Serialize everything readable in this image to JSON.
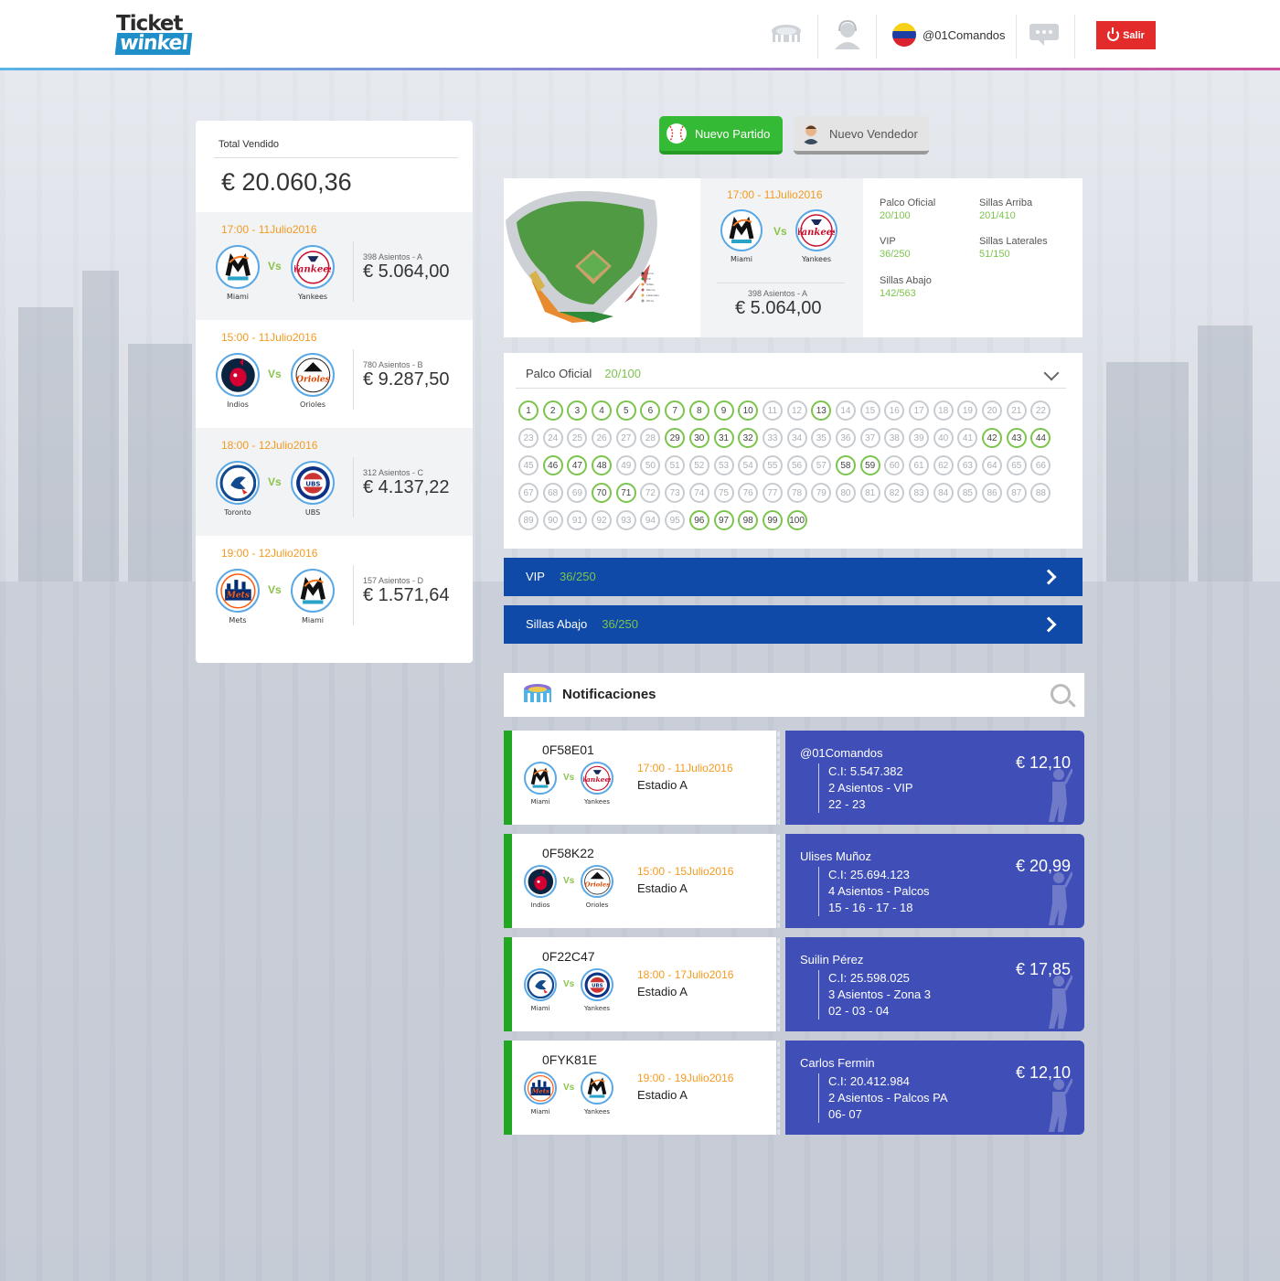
{
  "header": {
    "logo_line1": "Ticket",
    "logo_line2": "winkel",
    "username": "@01Comandos",
    "logout_label": "Salir",
    "icons": [
      "stadium-icon",
      "support-agent-icon",
      "venezuela-flag-icon",
      "chat-icon",
      "power-icon"
    ]
  },
  "summary": {
    "total_label": "Total Vendido",
    "total_value": "€ 20.060,36",
    "matches": [
      {
        "time": "17:00 - 11Julio2016",
        "home": "Miami",
        "away": "Yankees",
        "vs": "Vs",
        "seats": "398 Asientos - A",
        "price": "€ 5.064,00"
      },
      {
        "time": "15:00 - 11Julio2016",
        "home": "Indios",
        "away": "Orioles",
        "vs": "Vs",
        "seats": "780 Asientos - B",
        "price": "€ 9.287,50"
      },
      {
        "time": "18:00 - 12Julio2016",
        "home": "Toronto",
        "away": "UBS",
        "vs": "Vs",
        "seats": "312 Asientos - C",
        "price": "€ 4.137,22"
      },
      {
        "time": "19:00 - 12Julio2016",
        "home": "Mets",
        "away": "Miami",
        "vs": "Vs",
        "seats": "157 Asientos - D",
        "price": "€ 1.571,64"
      }
    ]
  },
  "actions": {
    "new_match": "Nuevo Partido",
    "new_seller": "Nuevo Vendedor"
  },
  "stadium": {
    "time": "17:00 - 11Julio2016",
    "home": "Miami",
    "away": "Yankees",
    "vs": "Vs",
    "seats": "398 Asientos - A",
    "price": "€ 5.064,00",
    "stats": [
      {
        "label": "Palco Oficial",
        "value": "20/100"
      },
      {
        "label": "Sillas Arriba",
        "value": "201/410"
      },
      {
        "label": "VIP",
        "value": "36/250"
      },
      {
        "label": "Sillas Laterales",
        "value": "51/150"
      },
      {
        "label": "Sillas Abajo",
        "value": "142/563"
      }
    ]
  },
  "palco": {
    "label": "Palco Oficial",
    "value": "20/100",
    "sold_seats": [
      1,
      2,
      3,
      4,
      5,
      6,
      7,
      8,
      9,
      10,
      13,
      29,
      30,
      31,
      32,
      42,
      43,
      44,
      46,
      47,
      48,
      58,
      59,
      70,
      71,
      96,
      97,
      98,
      99,
      100
    ],
    "total_seats": 100
  },
  "sections": [
    {
      "label": "VIP",
      "value": "36/250"
    },
    {
      "label": "Sillas Abajo",
      "value": "36/250"
    }
  ],
  "notifications": {
    "title": "Notificaciones",
    "items": [
      {
        "code": "0F58E01",
        "home": "Miami",
        "away": "Yankees",
        "vs": "Vs",
        "time": "17:00 - 11Julio2016",
        "stadium": "Estadio A",
        "buyer": "@01Comandos",
        "ci": "C.I: 5.547.382",
        "seats": "2 Asientos - VIP",
        "numbers": "22 - 23",
        "price": "€ 12,10"
      },
      {
        "code": "0F58K22",
        "home": "Indios",
        "away": "Orioles",
        "vs": "Vs",
        "time": "15:00 - 15Julio2016",
        "stadium": "Estadio A",
        "buyer": "Ulises Muñoz",
        "ci": "C.I: 25.694.123",
        "seats": "4 Asientos - Palcos",
        "numbers": "15 - 16 - 17 - 18",
        "price": "€ 20,99"
      },
      {
        "code": "0F22C47",
        "home": "Miami",
        "away": "Yankees",
        "vs": "Vs",
        "time": "18:00 - 17Julio2016",
        "stadium": "Estadio A",
        "buyer": "Suilin Pérez",
        "ci": "C.I: 25.598.025",
        "seats": "3 Asientos - Zona 3",
        "numbers": "02 - 03 - 04",
        "price": "€ 17,85"
      },
      {
        "code": "0FYK81E",
        "home": "Miami",
        "away": "Yankees",
        "vs": "Vs",
        "time": "19:00 - 19Julio2016",
        "stadium": "Estadio A",
        "buyer": "Carlos Fermin",
        "ci": "C.I: 20.412.984",
        "seats": "2 Asientos - Palcos PA",
        "numbers": "06- 07",
        "price": "€ 12,10"
      }
    ]
  },
  "colors": {
    "accent_orange": "#f39a1f",
    "accent_green": "#7cc44d",
    "section_blue": "#0f4aa8",
    "buyer_blue": "#3f4fb7",
    "logout_red": "#e32b2b"
  }
}
